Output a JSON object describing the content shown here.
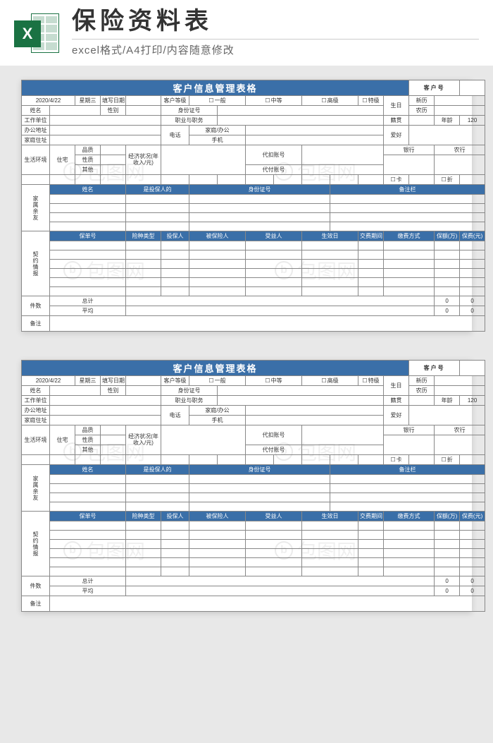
{
  "header": {
    "title": "保险资料表",
    "subtitle": "excel格式/A4打印/内容随意修改",
    "iconLetter": "X"
  },
  "sheet": {
    "mainTitle": "客户信息管理表格",
    "customerNoLabel": "客户号",
    "date": "2020/4/22",
    "weekday": "星期三",
    "fillDateLabel": "填写日期",
    "custLevelLabel": "客户等级",
    "levels": {
      "l1": "一般",
      "l2": "中等",
      "l3": "高级",
      "l4": "特级"
    },
    "birthdayLabel": "生日",
    "solarLabel": "新历",
    "lunarLabel": "农历",
    "nameLabel": "姓名",
    "genderLabel": "性别",
    "idLabel": "身份证号",
    "workUnitLabel": "工作单位",
    "jobDutyLabel": "职业与职务",
    "nativeLabel": "籍贯",
    "ageLabel": "年龄",
    "ageValue": "120",
    "officeAddrLabel": "办公地址",
    "phoneLabel": "电话",
    "homeOfficeLabel": "家庭/办公",
    "mobileLabel": "手机",
    "hobbyLabel": "爱好",
    "homeAddrLabel": "家庭住址",
    "lifeEnvLabel": "生活环境",
    "houseLabel": "住宅",
    "qualityLabel": "品质",
    "natureLabel": "性质",
    "otherLabel": "其他",
    "economyLabel": "经济状况(年收入/元)",
    "withholdLabel": "代扣账号",
    "payLabel": "代付账号",
    "bankLabel": "银行",
    "nonghangLabel": "农行",
    "cardLabel": "卡",
    "zheLabel": "折",
    "familySection": "家属亲友",
    "familyHeaders": {
      "h1": "姓名",
      "h2": "是投保人的",
      "h3": "身份证号",
      "h4": "备注栏"
    },
    "contractSection": "契约情报",
    "contractHeaders": {
      "c1": "保单号",
      "c2": "险种类型",
      "c3": "投保人",
      "c4": "被保险人",
      "c5": "受益人",
      "c6": "生效日",
      "c7": "交费期间",
      "c8": "缴费方式",
      "c9": "保额(万)",
      "c10": "保费(元)"
    },
    "countLabel": "件数",
    "totalLabel": "总计",
    "avgLabel": "平均",
    "zero": "0",
    "remarkLabel": "备注"
  },
  "watermark": "包图网"
}
